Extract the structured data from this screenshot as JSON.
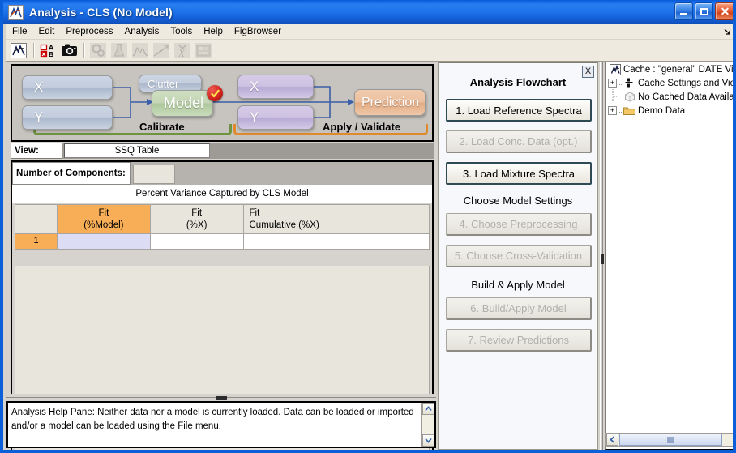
{
  "window": {
    "title_main": "Analysis",
    "title_sep": " - ",
    "title_sub": "CLS (No Model)",
    "app_icon": "matlab-lambda-icon",
    "minimize_label": "Minimize",
    "maximize_label": "Maximize",
    "close_label": "Close"
  },
  "menubar": {
    "items": [
      {
        "label": "File"
      },
      {
        "label": "Edit"
      },
      {
        "label": "Preprocess"
      },
      {
        "label": "Analysis"
      },
      {
        "label": "Tools"
      },
      {
        "label": "Help"
      },
      {
        "label": "FigBrowser"
      }
    ],
    "overflow_icon": "chevron-corner-icon"
  },
  "toolbar": {
    "buttons": [
      {
        "name": "analysis-lambda-icon",
        "enabled": true
      },
      {
        "name": "ab-table-icon",
        "enabled": true
      },
      {
        "name": "camera-icon",
        "enabled": true
      },
      {
        "name": "gears-icon",
        "enabled": false
      },
      {
        "name": "flask-icon",
        "enabled": false
      },
      {
        "name": "spectra-plot-icon",
        "enabled": false
      },
      {
        "name": "scatter-plot-icon",
        "enabled": false
      },
      {
        "name": "x-hat-icon",
        "enabled": false
      },
      {
        "name": "image-data-icon",
        "enabled": false
      }
    ]
  },
  "diagram": {
    "nodes": [
      {
        "id": "cal-x",
        "label": "X",
        "color": "blue"
      },
      {
        "id": "cal-y",
        "label": "Y",
        "color": "blue"
      },
      {
        "id": "clutter",
        "label": "Clutter",
        "color": "blue"
      },
      {
        "id": "model",
        "label": "Model",
        "color": "green"
      },
      {
        "id": "apply-x",
        "label": "X",
        "color": "purple"
      },
      {
        "id": "apply-y",
        "label": "Y",
        "color": "purple"
      },
      {
        "id": "prediction",
        "label": "Prediction",
        "color": "orange"
      }
    ],
    "calibrate_label": "Calibrate",
    "apply_label": "Apply / Validate",
    "calibrate_bracket_color": "#6e9441",
    "apply_bracket_color": "#e08a2e",
    "check_badge": "red-check-badge-icon",
    "arrow_color": "#3b5fa8"
  },
  "view_row": {
    "label": "View:",
    "selected": "SSQ Table"
  },
  "components": {
    "label": "Number of Components:",
    "value": "",
    "placeholder": ""
  },
  "table": {
    "caption": "Percent Variance Captured by CLS Model",
    "headers": [
      {
        "line1": "",
        "line2": "",
        "selected": false
      },
      {
        "line1": "Fit",
        "line2": "(%Model)",
        "selected": true
      },
      {
        "line1": "Fit",
        "line2": "(%X)",
        "selected": false
      },
      {
        "line1": "Fit",
        "line2": "Cumulative (%X)",
        "selected": false
      },
      {
        "line1": "",
        "line2": "",
        "selected": false
      }
    ],
    "rows": [
      {
        "header": "1",
        "cells": [
          "",
          "",
          "",
          ""
        ]
      }
    ]
  },
  "help_pane": {
    "text": "Analysis Help Pane: Neither data nor a model is currently loaded. Data can be loaded or imported and/or a model can be loaded using the File menu.",
    "scroll_up_icon": "chevron-up-icon",
    "scroll_down_icon": "chevron-down-icon"
  },
  "flowchart": {
    "title": "Analysis Flowchart",
    "close_label": "X",
    "items": [
      {
        "type": "button",
        "label": "1. Load Reference Spectra",
        "state": "active"
      },
      {
        "type": "button",
        "label": "2. Load Conc. Data (opt.)",
        "state": "disabled"
      },
      {
        "type": "button",
        "label": "3. Load Mixture Spectra",
        "state": "active"
      },
      {
        "type": "section",
        "label": "Choose Model Settings"
      },
      {
        "type": "button",
        "label": "4. Choose Preprocessing",
        "state": "disabled"
      },
      {
        "type": "button",
        "label": "5. Choose Cross-Validation",
        "state": "disabled"
      },
      {
        "type": "section",
        "label": "Build & Apply Model"
      },
      {
        "type": "button",
        "label": "6. Build/Apply Model",
        "state": "disabled"
      },
      {
        "type": "button",
        "label": "7. Review Predictions",
        "state": "disabled"
      }
    ]
  },
  "tree": {
    "rows": [
      {
        "label": "Cache : \"general\" DATE View",
        "icon": "matlab-lambda-icon",
        "expander": "none",
        "indent": 0
      },
      {
        "label": "Cache Settings and View",
        "icon": "settings-blocks-icon",
        "expander": "plus",
        "indent": 1
      },
      {
        "label": "No Cached Data Available",
        "icon": "empty-box-icon",
        "expander": "none",
        "indent": 1
      },
      {
        "label": "Demo Data",
        "icon": "folder-icon",
        "expander": "plus",
        "indent": 1
      }
    ],
    "hscroll": {
      "left_arrow_icon": "chevron-left-icon",
      "thumb_grip_icon": "grip-dots-icon"
    }
  }
}
